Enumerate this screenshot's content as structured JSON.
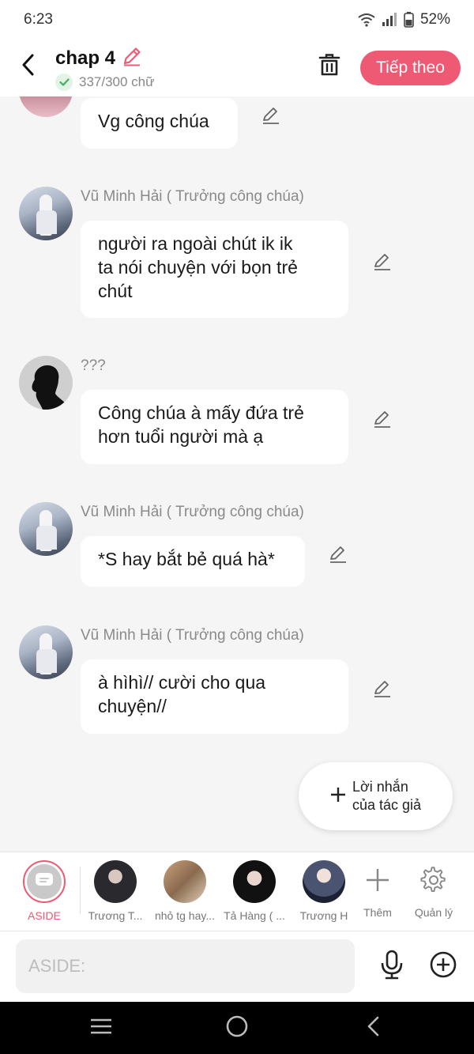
{
  "status_bar": {
    "time": "6:23",
    "battery": "52%"
  },
  "header": {
    "title": "chap 4",
    "word_count": "337/300 chữ",
    "next_label": "Tiếp theo",
    "accent_color": "#ee5a74"
  },
  "messages": [
    {
      "sender": "",
      "text": "Vg công chúa"
    },
    {
      "sender": "Vũ Minh Hải ( Trưởng công chúa)",
      "text": "người ra ngoài chút ik ik\nta nói chuyện với bọn trẻ\nchút"
    },
    {
      "sender": "???",
      "text": "Công chúa à mấy đứa trẻ\nhơn tuổi người mà ạ"
    },
    {
      "sender": "Vũ Minh Hải ( Trưởng công chúa)",
      "text": "*S hay bắt bẻ quá hà*"
    },
    {
      "sender": "Vũ Minh Hải ( Trưởng công chúa)",
      "text": "à hìhì// cười cho qua\nchuyện//"
    }
  ],
  "author_note": {
    "line1": "Lời nhắn",
    "line2": "của tác giả"
  },
  "characters": [
    {
      "label": "ASIDE"
    },
    {
      "label": "Trương T..."
    },
    {
      "label": "nhỏ tg hay..."
    },
    {
      "label": "Tả Hàng ( ..."
    },
    {
      "label": "Trương H"
    }
  ],
  "tools": {
    "add_label": "Thêm",
    "manage_label": "Quản lý"
  },
  "input": {
    "placeholder": "ASIDE:",
    "value": ""
  }
}
